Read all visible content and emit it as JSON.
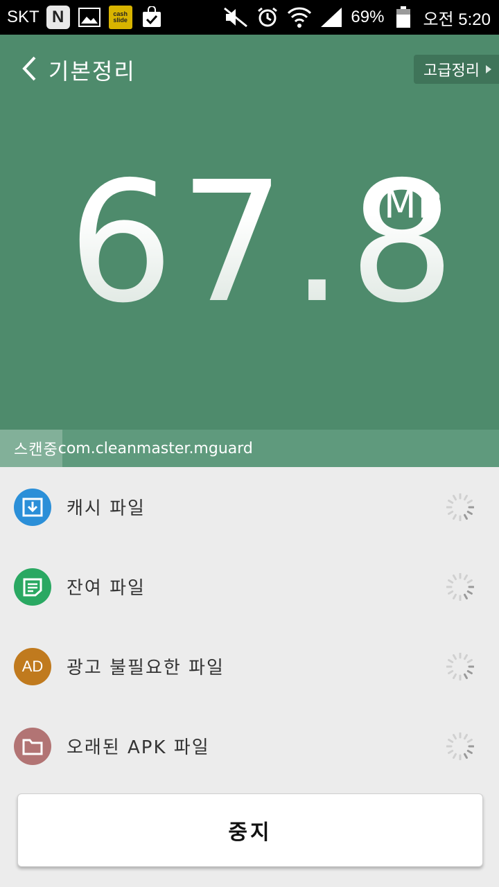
{
  "statusbar": {
    "carrier": "SKT",
    "cash_badge_text": "cash slide",
    "battery": "69%",
    "time": "오전 5:20"
  },
  "header": {
    "back_title": "기본정리",
    "advanced_label": "고급정리",
    "size_value": "67.8",
    "size_unit": "MB",
    "bg_color": "#4e8b6c"
  },
  "scan": {
    "label": "스캔중",
    "package": "com.cleanmaster.mguard",
    "progress": 0.125
  },
  "items": [
    {
      "label": "캐시 파일",
      "icon": "download-box-icon",
      "color": "#2b8fd8"
    },
    {
      "label": "잔여 파일",
      "icon": "document-icon",
      "color": "#2aa862"
    },
    {
      "label": "광고 불필요한 파일",
      "icon": "ad-icon",
      "icon_text": "AD",
      "color": "#c07a1e"
    },
    {
      "label": "오래된 APK 파일",
      "icon": "folder-icon",
      "color": "#b27474"
    }
  ],
  "stop_label": "중지"
}
